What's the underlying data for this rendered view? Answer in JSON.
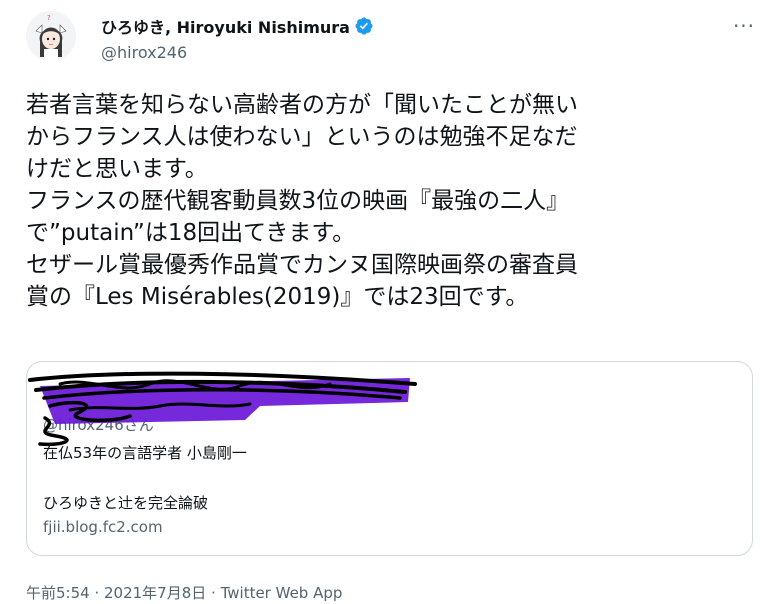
{
  "author": {
    "display_name": "ひろゆき, Hiroyuki Nishimura",
    "handle": "@hirox246",
    "verified": true
  },
  "menu": {
    "more_glyph": "···"
  },
  "tweet": {
    "lines": [
      "若者言葉を知らない高齢者の方が「聞いたことが無い",
      "からフランス人は使わない」というのは勉強不足なだ",
      "けだと思います。",
      "フランスの歴代観客動員数3位の映画『最強の二人』",
      "で”putain”は18回出てきます。",
      "セザール賞最優秀作品賞でカンヌ国際映画祭の審査員",
      "賞の『Les Misérables(2019)』では23回です。"
    ]
  },
  "card": {
    "quoted_handle": "@hirox246さん",
    "title": "在仏53年の言語学者 小島剛一",
    "description": "ひろゆきと辻を完全論破",
    "domain": "fjii.blog.fc2.com"
  },
  "meta": {
    "time": "午前5:54",
    "date": "2021年7月8日",
    "separator": " · ",
    "source": "Twitter Web App"
  },
  "colors": {
    "text_primary": "#0f1419",
    "text_secondary": "#536471",
    "verified_blue": "#1d9bf0",
    "card_border": "#cfd9de",
    "scribble_black": "#000000",
    "scribble_purple": "#6a16d8"
  }
}
